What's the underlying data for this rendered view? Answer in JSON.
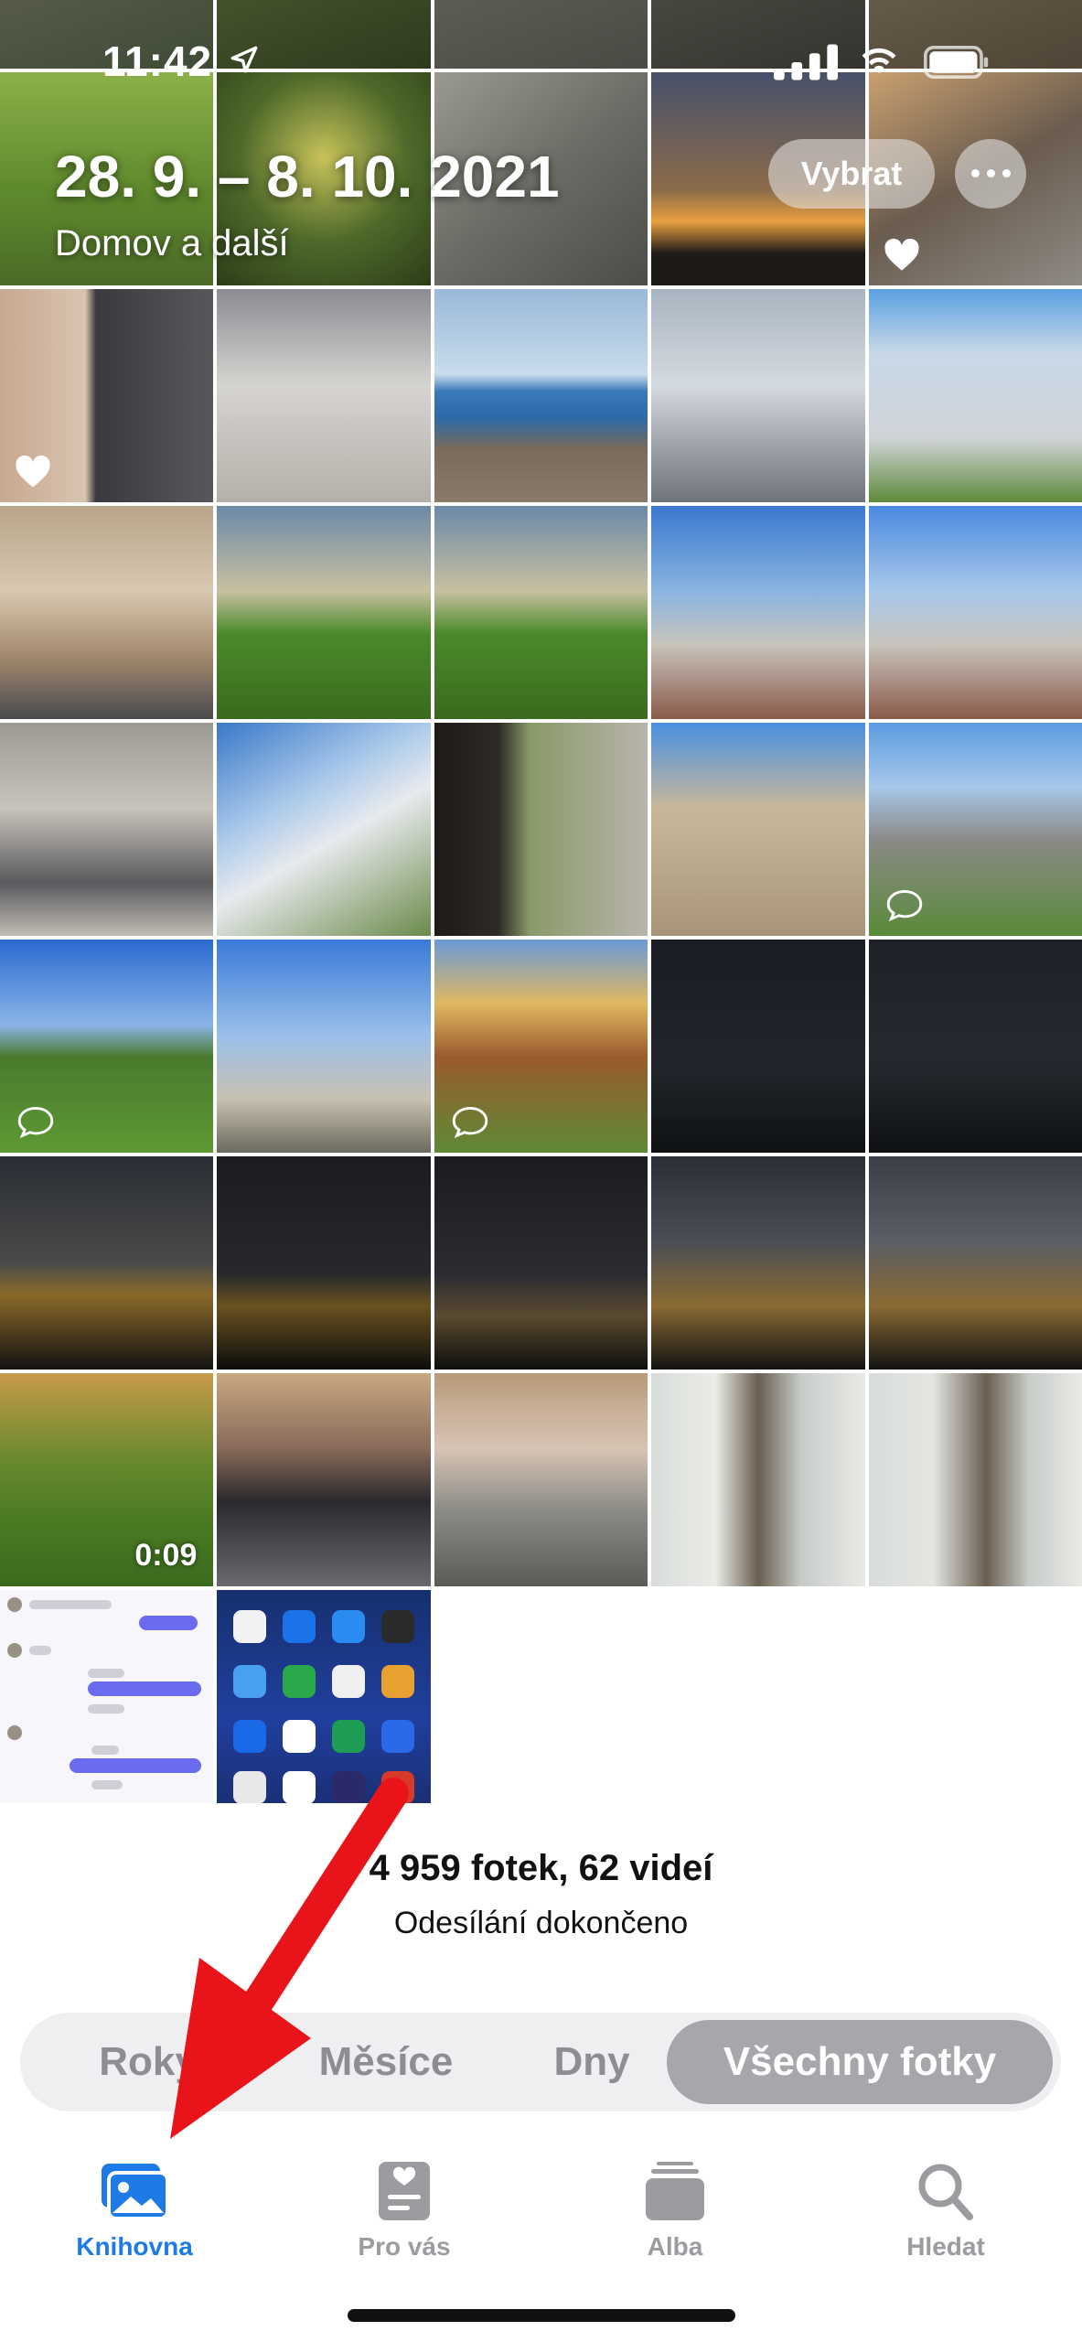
{
  "status_bar": {
    "time": "11:42"
  },
  "header": {
    "title": "28. 9. – 8. 10. 2021",
    "subtitle": "Domov a další",
    "select_label": "Vybrat"
  },
  "grid": {
    "video_duration": "0:09"
  },
  "footer": {
    "count": "4 959 fotek, 62 videí",
    "upload_status": "Odesílání dokončeno"
  },
  "segments": [
    "Roky",
    "Měsíce",
    "Dny",
    "Všechny fotky"
  ],
  "segments_active": "Všechny fotky",
  "tabs": [
    {
      "label": "Knihovna",
      "icon": "photo-library-icon",
      "active": true
    },
    {
      "label": "Pro vás",
      "icon": "for-you-icon",
      "active": false
    },
    {
      "label": "Alba",
      "icon": "albums-icon",
      "active": false
    },
    {
      "label": "Hledat",
      "icon": "search-icon",
      "active": false
    }
  ],
  "colors": {
    "accent": "#1e7ae6",
    "arrow": "#e8141a",
    "inactive": "#9b9ba0"
  }
}
